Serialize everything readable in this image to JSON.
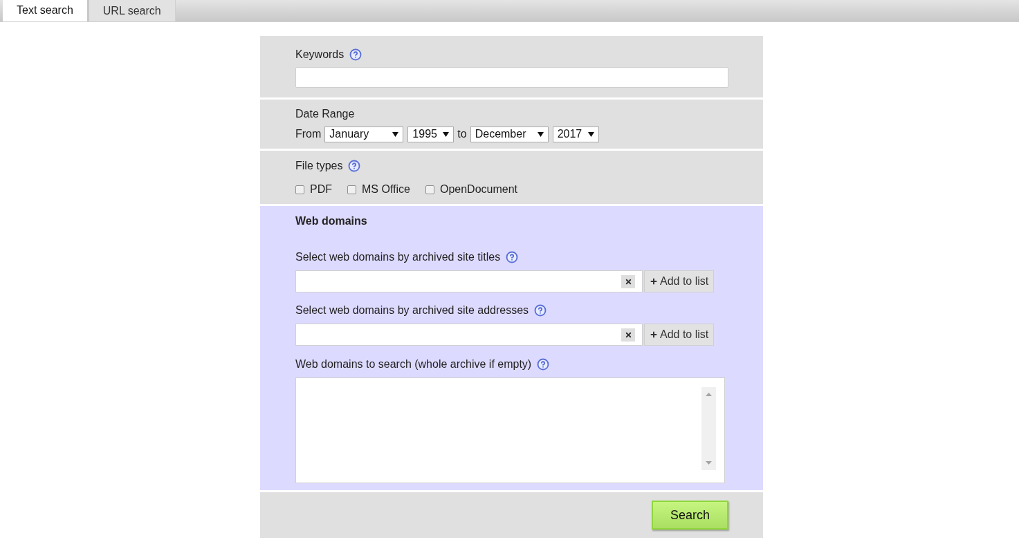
{
  "tabs": [
    {
      "label": "Text search",
      "selected": true
    },
    {
      "label": "URL search",
      "selected": false
    }
  ],
  "keywords": {
    "label": "Keywords"
  },
  "date_range": {
    "label": "Date Range",
    "from_label": "From",
    "from_month": "January",
    "from_year": "1995",
    "to_label": "to",
    "to_month": "December",
    "to_year": "2017"
  },
  "file_types": {
    "label": "File types",
    "options": [
      {
        "label": "PDF",
        "checked": false
      },
      {
        "label": "MS Office",
        "checked": false
      },
      {
        "label": "OpenDocument",
        "checked": false
      }
    ]
  },
  "web_domains": {
    "title": "Web domains",
    "pickers": [
      {
        "label": "Select web domains by archived site titles",
        "button": "Add to list"
      },
      {
        "label": "Select web domains by archived site addresses",
        "button": "Add to list"
      }
    ],
    "list_label": "Web domains to search (whole archive if empty)"
  },
  "search_button": "Search"
}
